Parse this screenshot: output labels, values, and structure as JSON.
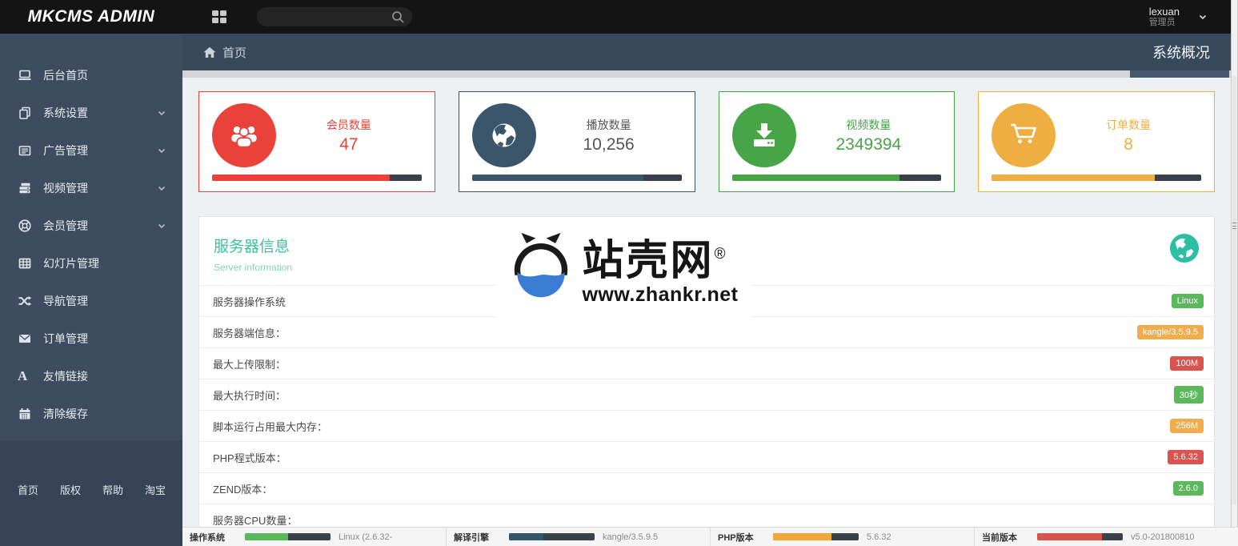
{
  "topbar": {
    "logo": "MKCMS ADMIN",
    "search_placeholder": "",
    "user_name": "lexuan",
    "user_role": "管理员"
  },
  "breadcrumb": {
    "home": "首页",
    "page_title": "系统概况"
  },
  "sidebar": {
    "items": [
      {
        "label": "后台首页"
      },
      {
        "label": "系统设置"
      },
      {
        "label": "广告管理"
      },
      {
        "label": "视频管理"
      },
      {
        "label": "会员管理"
      },
      {
        "label": "幻灯片管理"
      },
      {
        "label": "导航管理"
      },
      {
        "label": "订单管理"
      },
      {
        "label": "友情链接"
      },
      {
        "label": "清除缓存"
      }
    ],
    "footer_links": [
      {
        "label": "首页"
      },
      {
        "label": "版权"
      },
      {
        "label": "帮助"
      },
      {
        "label": "淘宝"
      }
    ]
  },
  "cards": [
    {
      "label": "会员数量",
      "value": "47",
      "color": "#e8423a",
      "value_color": "#e8423a",
      "progress": "85%"
    },
    {
      "label": "播放数量",
      "value": "10,256",
      "color": "#3b566b",
      "value_color": "#555555",
      "progress": "82%"
    },
    {
      "label": "视频数量",
      "value": "2349394",
      "color": "#47a447",
      "value_color": "#47a447",
      "progress": "80%"
    },
    {
      "label": "订单数量",
      "value": "8",
      "color": "#efae42",
      "value_color": "#efae42",
      "progress": "78%"
    }
  ],
  "panel": {
    "title": "服务器信息",
    "subtitle": "Server information",
    "rows": [
      {
        "label": "服务器操作系统",
        "badge": "Linux",
        "badge_color": "#5cb85c"
      },
      {
        "label": "服务器端信息：",
        "badge": "kangle/3.5.9.5",
        "badge_color": "#f0ad4e"
      },
      {
        "label": "最大上传限制：",
        "badge": "100M",
        "badge_color": "#d9534f"
      },
      {
        "label": "最大执行时间：",
        "badge": "30秒",
        "badge_color": "#5cb85c"
      },
      {
        "label": "脚本运行占用最大内存：",
        "badge": "256M",
        "badge_color": "#f0ad4e"
      },
      {
        "label": "PHP程式版本：",
        "badge": "5.6.32",
        "badge_color": "#d9534f"
      },
      {
        "label": "ZEND版本：",
        "badge": "2.6.0",
        "badge_color": "#5cb85c"
      },
      {
        "label": "服务器CPU数量：",
        "badge": "",
        "badge_color": ""
      }
    ]
  },
  "watermark": {
    "brand": "站壳网",
    "reg": "®",
    "url": "www.zhankr.net"
  },
  "statusbar": {
    "segments": [
      {
        "label": "操作系统",
        "value": "Linux (2.6.32-",
        "color": "#5cb85c",
        "fill": "50%"
      },
      {
        "label": "解译引擎",
        "value": "kangle/3.5.9.5",
        "color": "#31566b",
        "fill": "40%"
      },
      {
        "label": "PHP版本",
        "value": "5.6.32",
        "color": "#f0a839",
        "fill": "68%"
      },
      {
        "label": "当前版本",
        "value": "v5.0-201800810",
        "color": "#d9534f",
        "fill": "76%"
      }
    ]
  }
}
